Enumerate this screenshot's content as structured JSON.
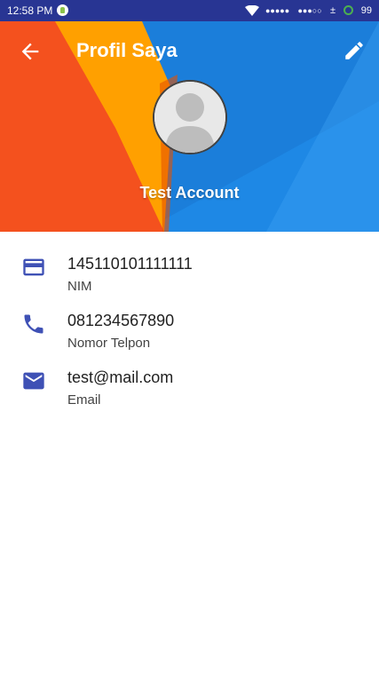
{
  "status_bar": {
    "time": "12:58 PM",
    "signal_1": "●●●●●",
    "signal_2": "●●●○○",
    "data_indicator": "±",
    "battery": "99"
  },
  "header": {
    "title": "Profil Saya",
    "account_name": "Test Account",
    "back_icon": "arrow-left-icon",
    "edit_icon": "pencil-icon"
  },
  "info": [
    {
      "icon": "card-icon",
      "value": "145110101111111",
      "label": "NIM"
    },
    {
      "icon": "phone-icon",
      "value": "081234567890",
      "label": "Nomor Telpon"
    },
    {
      "icon": "mail-icon",
      "value": "test@mail.com",
      "label": "Email"
    }
  ],
  "colors": {
    "status_bar": "#283593",
    "icon": "#3f51b5",
    "header_blue": "#1e88e5",
    "header_orange": "#f4511e",
    "header_amber": "#ffa000"
  }
}
